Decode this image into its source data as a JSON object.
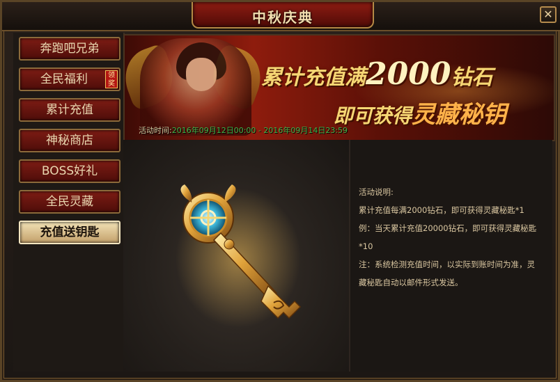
{
  "window": {
    "title": "中秋庆典",
    "close_label": "✕"
  },
  "sidebar": {
    "items": [
      {
        "label": "奔跑吧兄弟"
      },
      {
        "label": "全民福利",
        "badge": "领奖"
      },
      {
        "label": "累计充值"
      },
      {
        "label": "神秘商店"
      },
      {
        "label": "BOSS好礼"
      },
      {
        "label": "全民灵藏"
      },
      {
        "label": "充值送钥匙",
        "active": true
      }
    ]
  },
  "banner": {
    "line1_prefix": "累计充值满",
    "line1_number": "2000",
    "line1_suffix": "钻石",
    "line2_prefix": "即可获得",
    "line2_highlight": "灵藏秘钥",
    "time_label": "活动时间:",
    "time_value": "2016年09月12日00:00 - 2016年09月14日23:59"
  },
  "description": {
    "title": "活动说明:",
    "line1": "累计充值每满2000钻石，即可获得灵藏秘匙*1",
    "line2": "例：当天累计充值20000钻石，即可获得灵藏秘匙*10",
    "line3": "注：系统检测充值时间，以实际到账时间为准，灵藏秘匙自动以邮件形式发送。"
  },
  "colors": {
    "accent_gold": "#f6d774",
    "tab_red": "#7d1c14",
    "time_green": "#3fb34a"
  },
  "icons": {
    "reward_item": "golden-key-icon",
    "close": "close-icon"
  }
}
